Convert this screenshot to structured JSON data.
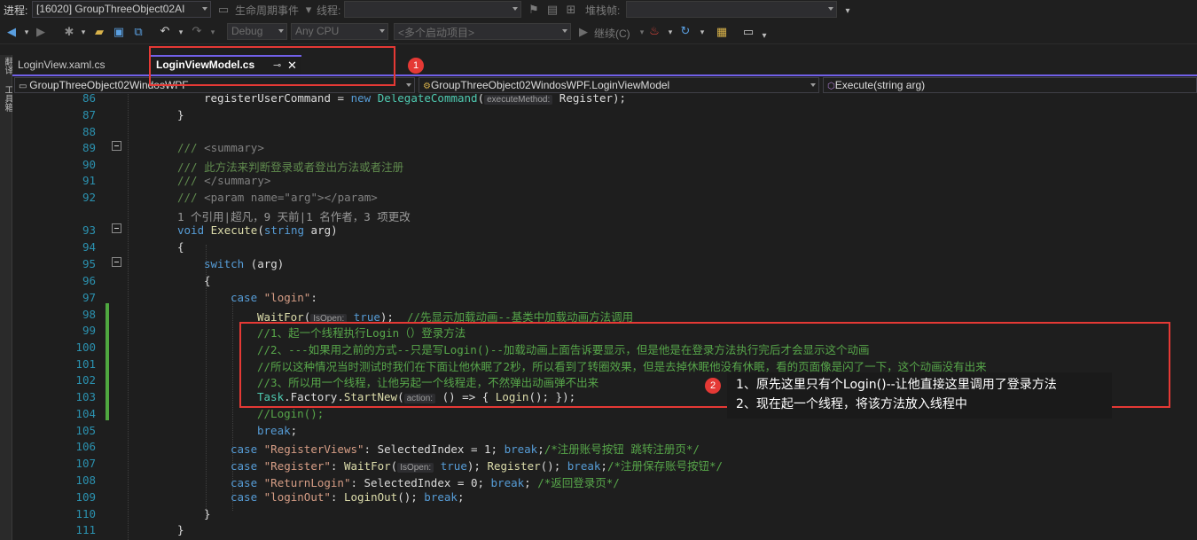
{
  "debug_bar": {
    "process_label": "进程:",
    "process_value": "[16020] GroupThreeObject02AI",
    "lifecycle_label": "生命周期事件",
    "thread_label": "线程:",
    "stack_label": "堆栈帧:"
  },
  "toolbar": {
    "config": "Debug",
    "platform": "Any CPU",
    "startup": "<多个启动项目>",
    "continue": "继续(C)"
  },
  "tabs": [
    {
      "label": "LoginView.xaml.cs",
      "active": false
    },
    {
      "label": "LoginViewModel.cs",
      "active": true
    }
  ],
  "nav": {
    "project": "GroupThreeObject02WindosWPF",
    "class": "GroupThreeObject02WindosWPF.LoginViewModel",
    "member": "Execute(string arg)"
  },
  "left_strip": {
    "label1": "翻译",
    "label2": "工具箱"
  },
  "code": {
    "lines": [
      {
        "n": "86",
        "t": "registerUserCommand = new DelegateCommand(executeMethod: Register);"
      },
      {
        "n": "87",
        "t": "}"
      },
      {
        "n": "88",
        "t": ""
      },
      {
        "n": "89",
        "t": "/// <summary>"
      },
      {
        "n": "90",
        "t": "/// 此方法来判断登录或者登出方法或者注册"
      },
      {
        "n": "91",
        "t": "/// </summary>"
      },
      {
        "n": "92",
        "t": "/// <param name=\"arg\"></param>"
      },
      {
        "n": "",
        "t": "1 个引用|超凡，9 天前|1 名作者，3 项更改"
      },
      {
        "n": "93",
        "t": "void Execute(string arg)"
      },
      {
        "n": "94",
        "t": "{"
      },
      {
        "n": "95",
        "t": "switch (arg)"
      },
      {
        "n": "96",
        "t": "{"
      },
      {
        "n": "97",
        "t": "case \"login\":"
      },
      {
        "n": "98",
        "t": "WaitFor(IsOpen: true);  //先显示加载动画--基类中加载动画方法调用"
      },
      {
        "n": "99",
        "t": "//1、起一个线程执行Login（）登录方法"
      },
      {
        "n": "100",
        "t": "//2、---如果用之前的方式--只是写Login()--加载动画上面告诉要显示，但是他是在登录方法执行完后才会显示这个动画"
      },
      {
        "n": "101",
        "t": "//所以这种情况当时测试时我们在下面让他休眠了2秒，所以看到了转圈效果，但是去掉休眠他没有休眠，看的页面像是闪了一下，这个动画没有出来"
      },
      {
        "n": "102",
        "t": "//3、所以用一个线程，让他另起一个线程走，不然弹出动画弹不出来"
      },
      {
        "n": "103",
        "t": "Task.Factory.StartNew(action: () => { Login(); });"
      },
      {
        "n": "104",
        "t": "//Login();"
      },
      {
        "n": "105",
        "t": "break;"
      },
      {
        "n": "106",
        "t": "case \"RegisterViews\": SelectedIndex = 1; break;/*注册账号按钮 跳转注册页*/"
      },
      {
        "n": "107",
        "t": "case \"Register\": WaitFor(IsOpen: true); Register(); break;/*注册保存账号按钮*/"
      },
      {
        "n": "108",
        "t": "case \"ReturnLogin\": SelectedIndex = 0; break; /*返回登录页*/"
      },
      {
        "n": "109",
        "t": "case \"loginOut\": LoginOut(); break;"
      },
      {
        "n": "110",
        "t": "}"
      },
      {
        "n": "111",
        "t": "}"
      }
    ]
  },
  "annotation": {
    "badge1": "1",
    "badge2": "2",
    "note_line1": "1、原先这里只有个Login()--让他直接这里调用了登录方法",
    "note_line2": "2、现在起一个线程，将该方法放入线程中"
  }
}
